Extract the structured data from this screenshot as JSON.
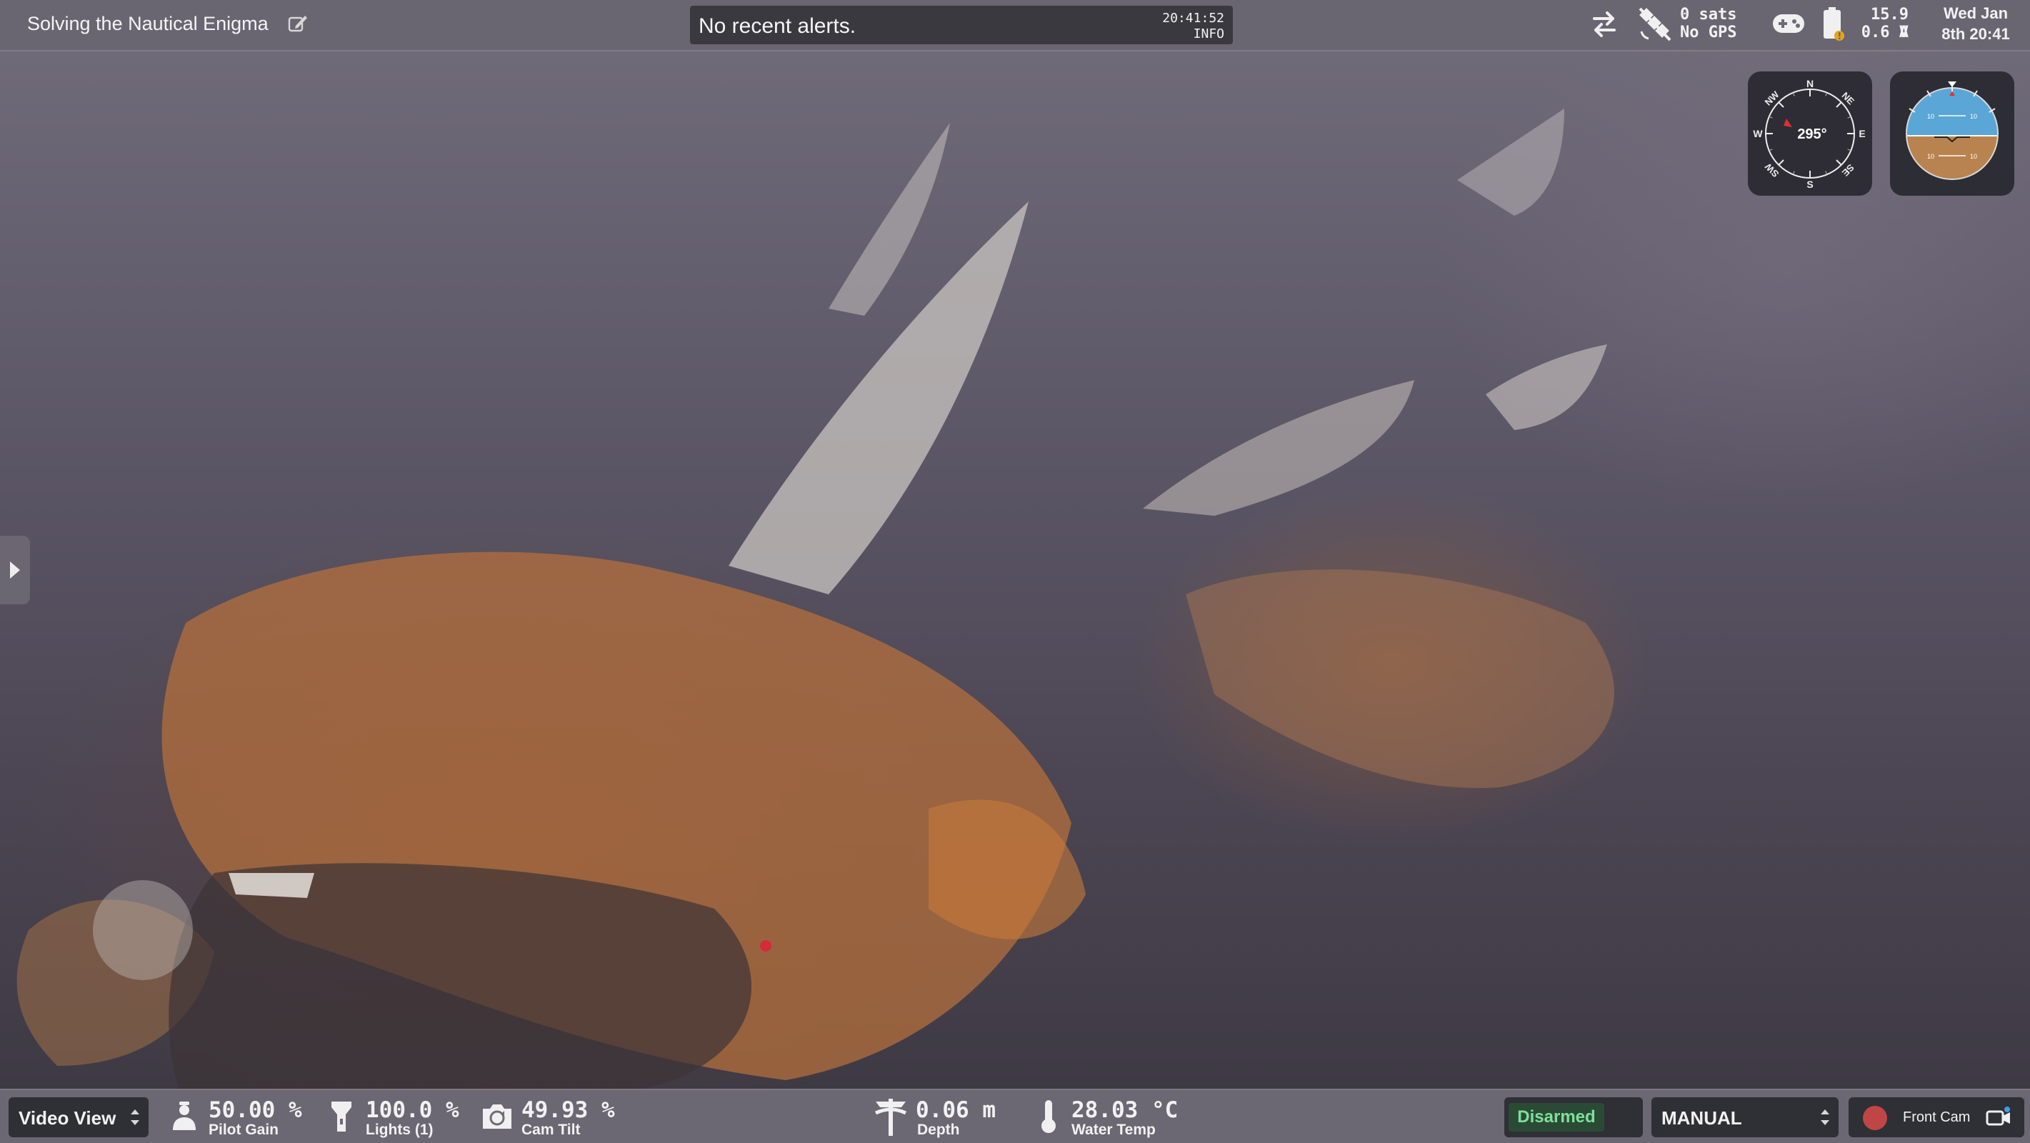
{
  "header": {
    "mission_name": "Solving the Nautical Enigma",
    "alert_message": "No recent alerts.",
    "alert_time": "20:41:52",
    "alert_level": "INFO",
    "gps_sats": "0 sats",
    "gps_status": "No GPS",
    "battery_voltage": "15.9 V",
    "battery_current": "0.6 A",
    "clock_line1": "Wed Jan",
    "clock_line2": "8th 20:41"
  },
  "instruments": {
    "heading_value": "295°",
    "compass_labels": {
      "n": "N",
      "ne": "NE",
      "e": "E",
      "se": "SE",
      "s": "S",
      "sw": "SW",
      "w": "W",
      "nw": "NW"
    },
    "pitch_labels": [
      "10",
      "10",
      "10",
      "10"
    ]
  },
  "bottom": {
    "view_label": "Video View",
    "pilot_gain_value": "50.00 %",
    "pilot_gain_caption": "Pilot Gain",
    "lights_value": "100.0 %",
    "lights_caption": "Lights (1)",
    "cam_tilt_value": "49.93 %",
    "cam_tilt_caption": "Cam Tilt",
    "depth_value": "0.06 m",
    "depth_caption": "Depth",
    "water_temp_value": "28.03 °C",
    "water_temp_caption": "Water Temp",
    "arm_status": "Disarmed",
    "flight_mode": "MANUAL",
    "camera_name": "Front Cam"
  },
  "colors": {
    "armed_badge_bg": "#2a4a36",
    "armed_badge_text": "#7ee09a",
    "record_dot": "#c04646",
    "sky": "#5aa6d6",
    "ground": "#b9834f"
  }
}
